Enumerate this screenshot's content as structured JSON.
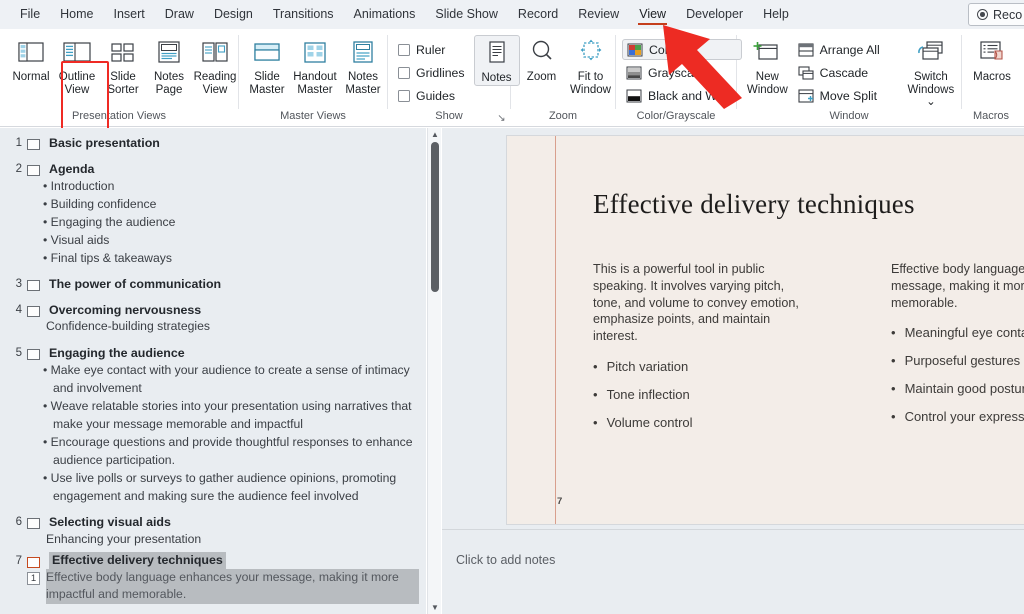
{
  "window": {
    "app": "PowerPoint",
    "record_button": "Reco"
  },
  "tabs": [
    {
      "label": "File",
      "active": false
    },
    {
      "label": "Home",
      "active": false
    },
    {
      "label": "Insert",
      "active": false
    },
    {
      "label": "Draw",
      "active": false
    },
    {
      "label": "Design",
      "active": false
    },
    {
      "label": "Transitions",
      "active": false
    },
    {
      "label": "Animations",
      "active": false
    },
    {
      "label": "Slide Show",
      "active": false
    },
    {
      "label": "Record",
      "active": false
    },
    {
      "label": "Review",
      "active": false
    },
    {
      "label": "View",
      "active": true
    },
    {
      "label": "Developer",
      "active": false
    },
    {
      "label": "Help",
      "active": false
    }
  ],
  "ribbon": {
    "groups": [
      {
        "name": "Presentation Views",
        "label": "Presentation Views",
        "buttons": [
          {
            "label": "Normal",
            "icon": "normal-view-icon"
          },
          {
            "label": "Outline View",
            "icon": "outline-view-icon",
            "highlighted": true
          },
          {
            "label": "Slide Sorter",
            "icon": "slide-sorter-icon"
          },
          {
            "label": "Notes Page",
            "icon": "notes-page-icon"
          },
          {
            "label": "Reading View",
            "icon": "reading-view-icon"
          }
        ]
      },
      {
        "name": "Master Views",
        "label": "Master Views",
        "buttons": [
          {
            "label": "Slide Master",
            "icon": "slide-master-icon"
          },
          {
            "label": "Handout Master",
            "icon": "handout-master-icon"
          },
          {
            "label": "Notes Master",
            "icon": "notes-master-icon"
          }
        ]
      },
      {
        "name": "Show",
        "label": "Show",
        "checkboxes": [
          {
            "label": "Ruler",
            "checked": false
          },
          {
            "label": "Gridlines",
            "checked": false
          },
          {
            "label": "Guides",
            "checked": false
          }
        ],
        "buttons": [
          {
            "label": "Notes",
            "icon": "notes-icon",
            "selected": true
          }
        ],
        "dialog_launcher": "↘"
      },
      {
        "name": "Zoom",
        "label": "Zoom",
        "buttons": [
          {
            "label": "Zoom",
            "icon": "magnifier-icon"
          },
          {
            "label": "Fit to Window",
            "icon": "fit-to-window-icon"
          }
        ]
      },
      {
        "name": "Color/Grayscale",
        "label": "Color/Grayscale",
        "items": [
          {
            "label": "Color",
            "icon": "color-swatch-icon",
            "selected": true
          },
          {
            "label": "Grayscale",
            "icon": "grayscale-swatch-icon"
          },
          {
            "label": "Black and White",
            "icon": "black-and-white-swatch-icon"
          }
        ]
      },
      {
        "name": "Window",
        "label": "Window",
        "buttons": [
          {
            "label": "New Window",
            "icon": "new-window-icon"
          },
          {
            "label": "Switch Windows",
            "icon": "switch-windows-icon",
            "dropdown": "⌄"
          }
        ],
        "items": [
          {
            "label": "Arrange All",
            "icon": "arrange-all-icon"
          },
          {
            "label": "Cascade",
            "icon": "cascade-icon"
          },
          {
            "label": "Move Split",
            "icon": "move-split-icon"
          }
        ]
      },
      {
        "name": "Macros",
        "label": "Macros",
        "buttons": [
          {
            "label": "Macros",
            "icon": "macros-icon"
          }
        ]
      }
    ]
  },
  "outline": {
    "slides": [
      {
        "number": "1",
        "title": "Basic presentation",
        "selected": false,
        "bullets": [],
        "sub": null
      },
      {
        "number": "2",
        "title": "Agenda",
        "selected": false,
        "bullets": [
          "Introduction",
          "Building confidence",
          "Engaging the audience",
          "Visual aids",
          "Final tips & takeaways"
        ],
        "sub": null
      },
      {
        "number": "3",
        "title": "The power of communication",
        "selected": false,
        "bullets": [],
        "sub": null
      },
      {
        "number": "4",
        "title": "Overcoming nervousness",
        "selected": false,
        "bullets": [],
        "sub": "Confidence-building strategies"
      },
      {
        "number": "5",
        "title": "Engaging the audience",
        "selected": false,
        "bullets": [
          "Make eye contact with your audience to create a sense of intimacy and involvement",
          "Weave relatable stories into your presentation using narratives that make your message memorable and impactful",
          "Encourage questions and provide thoughtful responses to enhance audience participation.",
          "Use live polls or surveys to gather audience opinions, promoting engagement and making sure the audience feel involved"
        ],
        "sub": null
      },
      {
        "number": "6",
        "title": "Selecting visual aids",
        "selected": false,
        "bullets": [],
        "sub": "Enhancing your presentation"
      },
      {
        "number": "7",
        "title": "Effective delivery techniques",
        "selected": true,
        "bullets": [],
        "sub": null,
        "sub_number": "1",
        "sub_text": "Effective body language enhances your message, making it more impactful and memorable."
      }
    ]
  },
  "slide": {
    "title": "Effective delivery techniques",
    "page_number": "7",
    "left_column": {
      "paragraph": "This is a powerful tool in public speaking. It involves varying pitch, tone, and volume to convey emotion, emphasize points, and maintain interest.",
      "bullets": [
        "Pitch variation",
        "Tone inflection",
        "Volume control"
      ]
    },
    "right_column": {
      "paragraph": "Effective body language enhances your message, making it more impactful and memorable.",
      "bullets": [
        "Meaningful eye contact",
        "Purposeful gestures",
        "Maintain good posture",
        "Control your expressions"
      ]
    }
  },
  "notes": {
    "placeholder": "Click to add notes"
  },
  "annotations": {
    "arrow_color": "#ED2B23",
    "highlight_color": "#EF2A24",
    "arrow_target": "View tab",
    "highlight_target": "Outline View button"
  },
  "colors": {
    "ribbon_bg": "#FFFFFF",
    "tabbar_bg": "#EEF1F5",
    "panel_bg": "#E9EDF1",
    "slide_bg": "#F3EDE8",
    "accent_line": "#D89F8D",
    "selection_grey": "#B8BCC0",
    "active_tab_underline": "#C43E1C"
  }
}
